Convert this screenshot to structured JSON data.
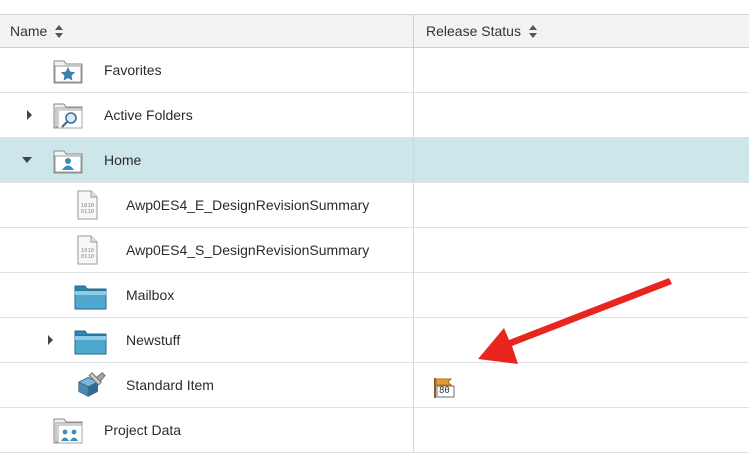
{
  "header": {
    "name_label": "Name",
    "status_label": "Release Status"
  },
  "rows": [
    {
      "label": "Favorites",
      "icon": "favorites-folder-icon",
      "toggle": "none",
      "level": 0,
      "status": ""
    },
    {
      "label": "Active Folders",
      "icon": "search-folder-icon",
      "toggle": "collapsed",
      "level": 0,
      "status": ""
    },
    {
      "label": "Home",
      "icon": "home-folder-icon",
      "toggle": "expanded",
      "level": 0,
      "status": "",
      "selected": true
    },
    {
      "label": "Awp0ES4_E_DesignRevisionSummary",
      "icon": "binary-file-icon",
      "toggle": "none",
      "level": 1,
      "status": ""
    },
    {
      "label": "Awp0ES4_S_DesignRevisionSummary",
      "icon": "binary-file-icon",
      "toggle": "none",
      "level": 1,
      "status": ""
    },
    {
      "label": "Mailbox",
      "icon": "folder-icon",
      "toggle": "none",
      "level": 1,
      "status": ""
    },
    {
      "label": "Newstuff",
      "icon": "folder-icon",
      "toggle": "collapsed",
      "level": 1,
      "status": ""
    },
    {
      "label": "Standard Item",
      "icon": "item-icon",
      "toggle": "none",
      "level": 1,
      "status": "release-80-flag-icon"
    },
    {
      "label": "Project Data",
      "icon": "project-folder-icon",
      "toggle": "none",
      "level": 0,
      "status": ""
    }
  ],
  "status_flag_text": "80",
  "colors": {
    "selected_row": "#cde6ea",
    "arrow": "#e8261f",
    "folder_blue": "#3d9cc0"
  }
}
